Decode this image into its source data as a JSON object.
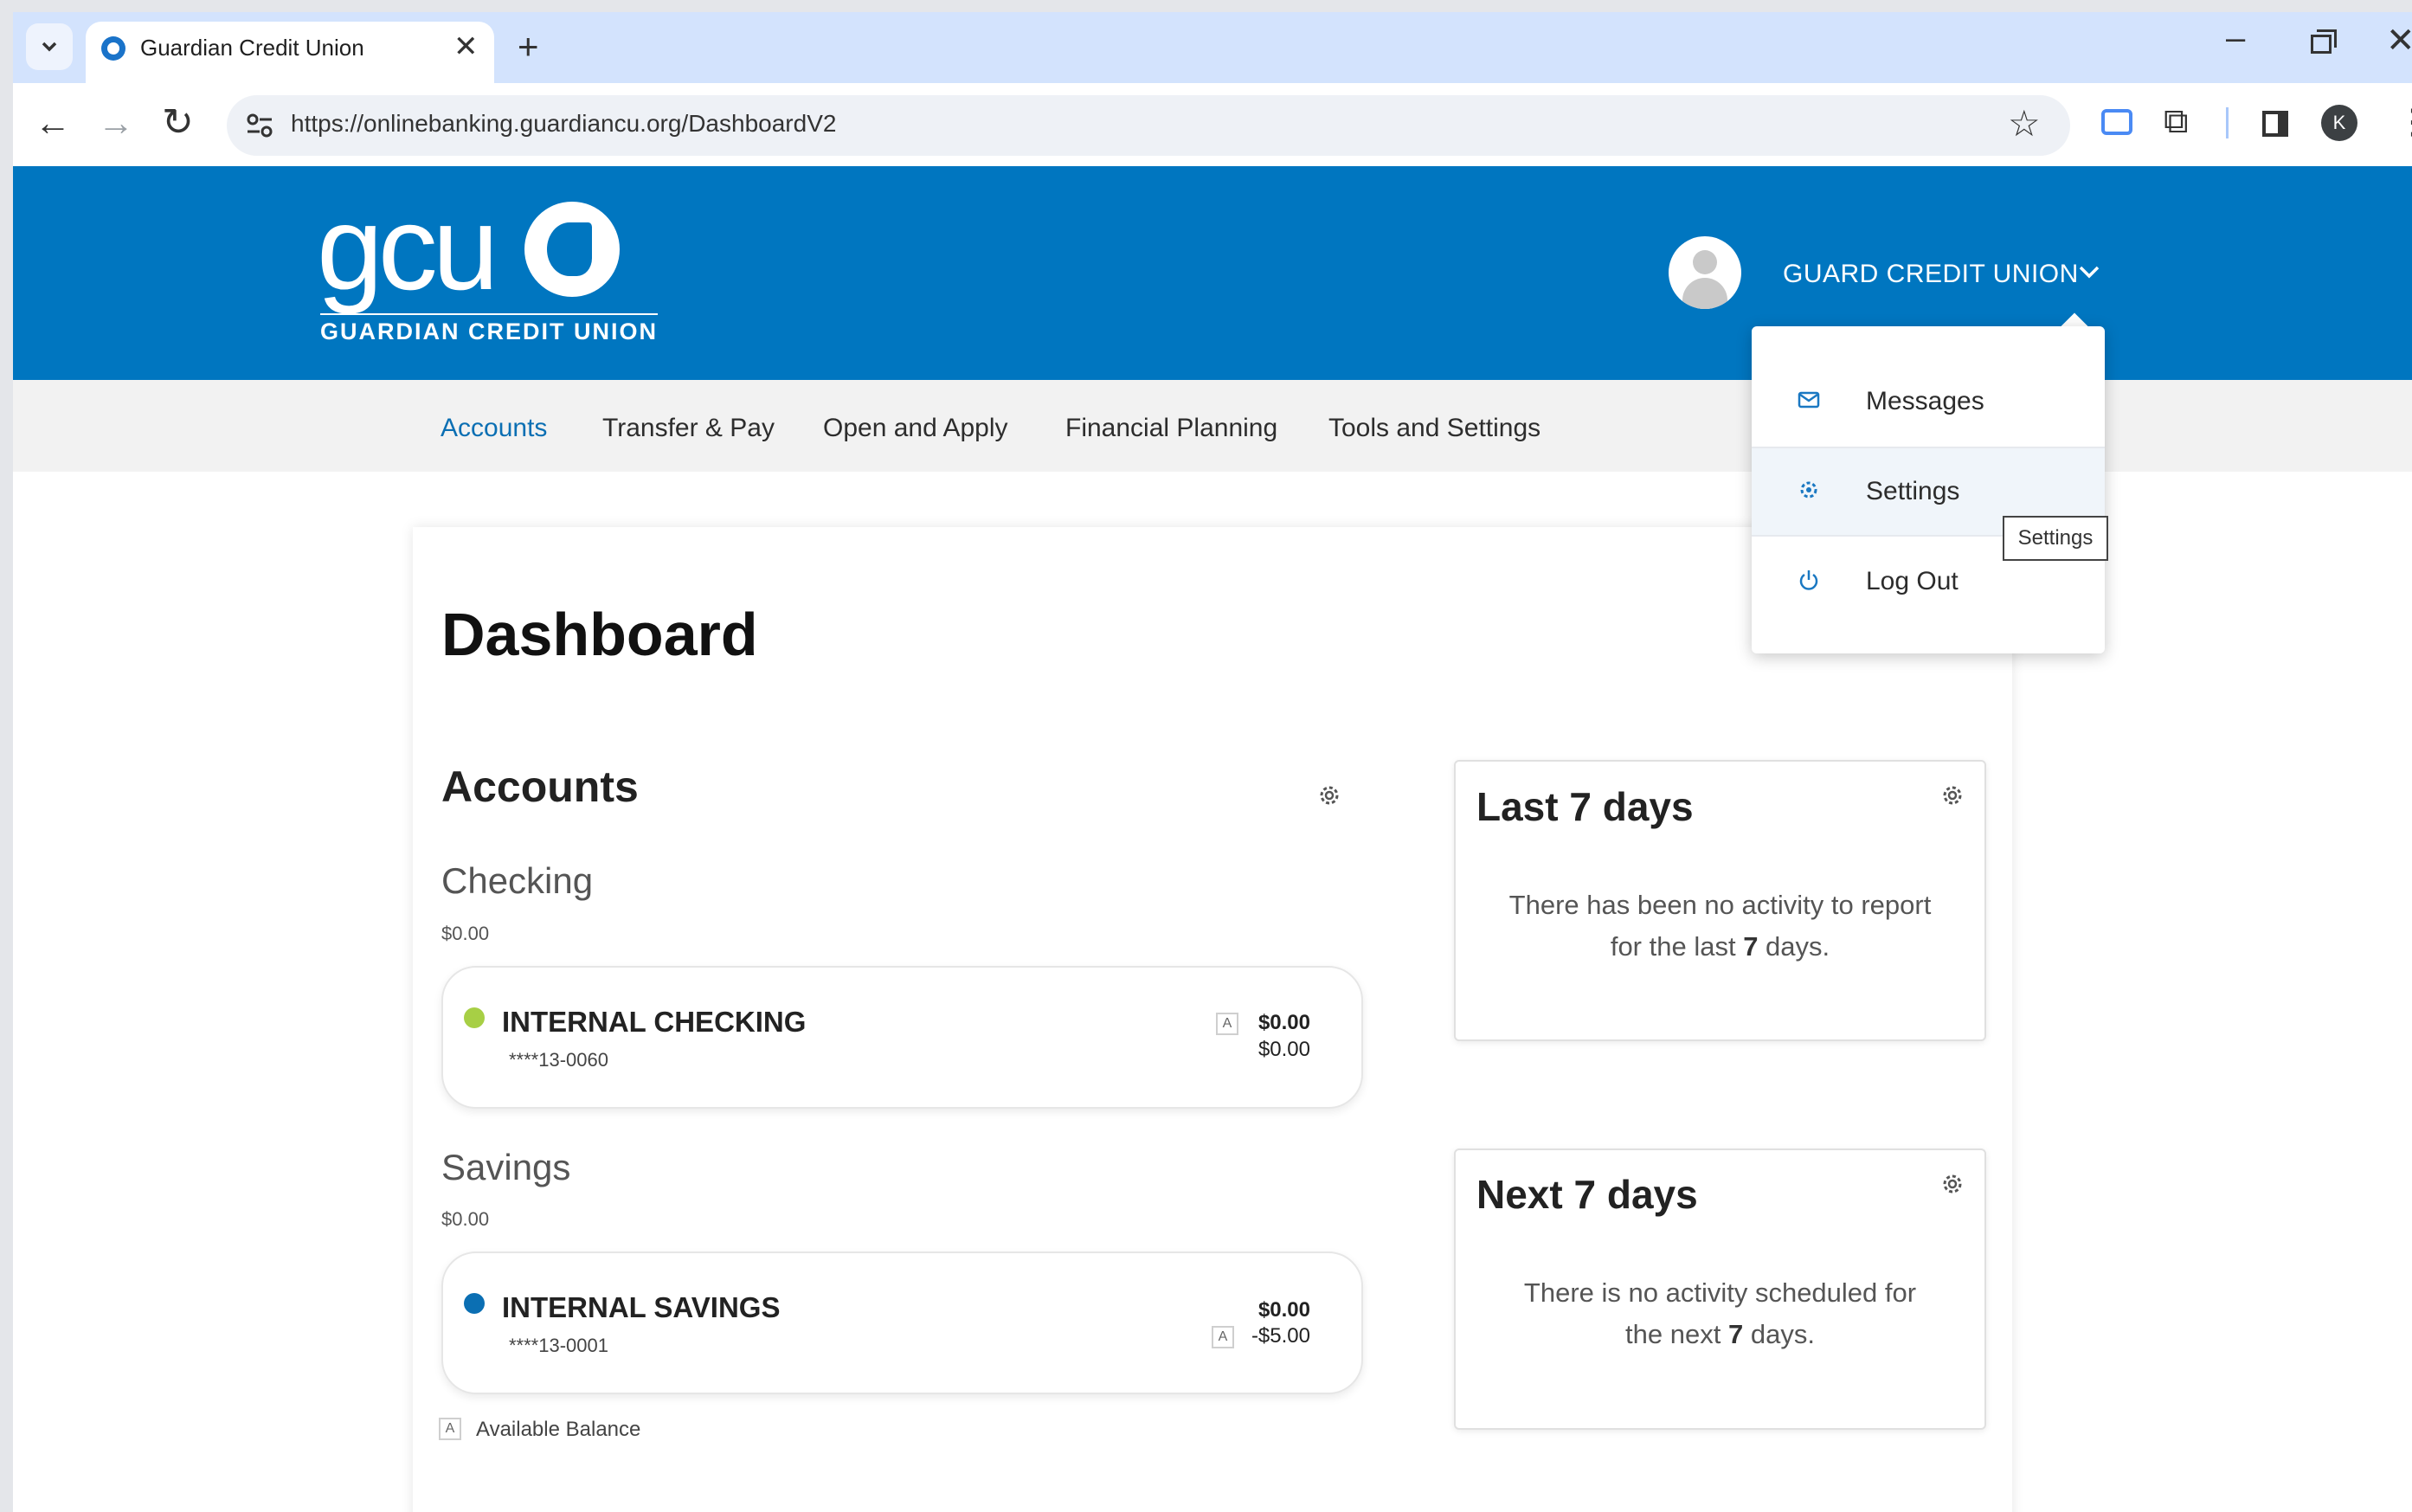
{
  "browser": {
    "tab_title": "Guardian Credit Union",
    "url": "https://onlinebanking.guardiancu.org/DashboardV2",
    "profile_initial": "K"
  },
  "brand": {
    "logo_text": "gcu",
    "logo_subtitle": "GUARDIAN CREDIT UNION",
    "user_name": "GUARD CREDIT UNION",
    "primary_color": "#0076c0"
  },
  "nav": {
    "items": [
      "Accounts",
      "Transfer & Pay",
      "Open and Apply",
      "Financial Planning",
      "Tools and Settings"
    ],
    "active": "Accounts"
  },
  "user_menu": {
    "items": [
      "Messages",
      "Settings",
      "Log Out"
    ],
    "tooltip": "Settings"
  },
  "dashboard": {
    "title": "Dashboard",
    "accounts_heading": "Accounts",
    "groups": [
      {
        "title": "Checking",
        "total": "$0.00",
        "account": {
          "name": "INTERNAL CHECKING",
          "number": "****13-0060",
          "amount_1": "$0.00",
          "amount_2": "$0.00",
          "badge": "A",
          "dot_color": "#a7cf45"
        }
      },
      {
        "title": "Savings",
        "total": "$0.00",
        "account": {
          "name": "INTERNAL SAVINGS",
          "number": "****13-0001",
          "amount_1": "$0.00",
          "amount_2": "-$5.00",
          "badge": "A",
          "dot_color": "#0b6fb3"
        }
      }
    ],
    "legend": {
      "badge": "A",
      "text": "Available Balance"
    },
    "last7": {
      "title": "Last 7 days",
      "line_1": "There has been no activity to report",
      "line_2_pre": "for the last ",
      "line_2_num": "7",
      "line_2_post": " days."
    },
    "next7": {
      "title": "Next 7 days",
      "line_1": "There is no activity scheduled for",
      "line_2_pre": "the next ",
      "line_2_num": "7",
      "line_2_post": " days."
    }
  }
}
